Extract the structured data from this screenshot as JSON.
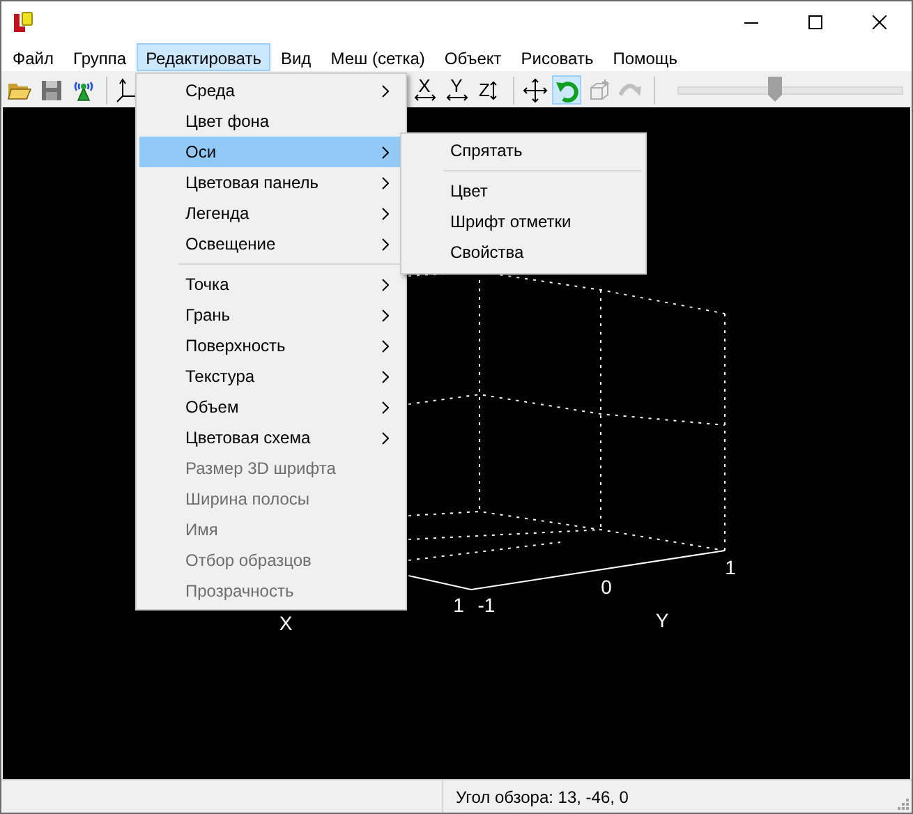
{
  "menubar": [
    {
      "label": "Файл",
      "selected": false
    },
    {
      "label": "Группа",
      "selected": false
    },
    {
      "label": "Редактировать",
      "selected": true
    },
    {
      "label": "Вид",
      "selected": false
    },
    {
      "label": "Меш (сетка)",
      "selected": false
    },
    {
      "label": "Объект",
      "selected": false
    },
    {
      "label": "Рисовать",
      "selected": false
    },
    {
      "label": "Помощь",
      "selected": false
    }
  ],
  "toolbar": {
    "left_tools": [
      {
        "kind": "button",
        "pressed": false,
        "disabled": false
      },
      {
        "kind": "button",
        "pressed": false,
        "disabled": false
      },
      {
        "kind": "button",
        "pressed": false,
        "disabled": false
      },
      {
        "kind": "separator"
      },
      {
        "kind": "button",
        "pressed": false,
        "disabled": false
      }
    ],
    "right_tools": [
      {
        "kind": "button",
        "label": "X",
        "pressed": false,
        "disabled": false
      },
      {
        "kind": "button",
        "label": "Y",
        "pressed": false,
        "disabled": false
      },
      {
        "kind": "button",
        "label": "Z",
        "pressed": false,
        "disabled": false
      },
      {
        "kind": "separator"
      },
      {
        "kind": "button",
        "pressed": false,
        "disabled": false
      },
      {
        "kind": "button",
        "pressed": true,
        "disabled": false
      },
      {
        "kind": "button",
        "pressed": false,
        "disabled": true
      },
      {
        "kind": "button",
        "pressed": false,
        "disabled": true
      },
      {
        "kind": "separator"
      },
      {
        "kind": "slider",
        "level": 0.43
      }
    ]
  },
  "edit_menu": [
    {
      "kind": "item",
      "label": "Среда",
      "submenu": true,
      "disabled": false,
      "selected": false
    },
    {
      "kind": "item",
      "label": "Цвет фона",
      "submenu": false,
      "disabled": false,
      "selected": false
    },
    {
      "kind": "item",
      "label": "Оси",
      "submenu": true,
      "disabled": false,
      "selected": true
    },
    {
      "kind": "item",
      "label": "Цветовая панель",
      "submenu": true,
      "disabled": false,
      "selected": false
    },
    {
      "kind": "item",
      "label": "Легенда",
      "submenu": true,
      "disabled": false,
      "selected": false
    },
    {
      "kind": "item",
      "label": "Освещение",
      "submenu": true,
      "disabled": false,
      "selected": false
    },
    {
      "kind": "separator"
    },
    {
      "kind": "item",
      "label": "Точка",
      "submenu": true,
      "disabled": false,
      "selected": false
    },
    {
      "kind": "item",
      "label": "Грань",
      "submenu": true,
      "disabled": false,
      "selected": false
    },
    {
      "kind": "item",
      "label": "Поверхность",
      "submenu": true,
      "disabled": false,
      "selected": false
    },
    {
      "kind": "item",
      "label": "Текстура",
      "submenu": true,
      "disabled": false,
      "selected": false
    },
    {
      "kind": "item",
      "label": "Объем",
      "submenu": true,
      "disabled": false,
      "selected": false
    },
    {
      "kind": "item",
      "label": "Цветовая схема",
      "submenu": true,
      "disabled": false,
      "selected": false
    },
    {
      "kind": "item",
      "label": "Размер 3D шрифта",
      "submenu": false,
      "disabled": true,
      "selected": false
    },
    {
      "kind": "item",
      "label": "Ширина полосы",
      "submenu": false,
      "disabled": true,
      "selected": false
    },
    {
      "kind": "item",
      "label": "Имя",
      "submenu": false,
      "disabled": true,
      "selected": false
    },
    {
      "kind": "item",
      "label": "Отбор образцов",
      "submenu": false,
      "disabled": true,
      "selected": false
    },
    {
      "kind": "item",
      "label": "Прозрачность",
      "submenu": false,
      "disabled": true,
      "selected": false
    }
  ],
  "axes_submenu": [
    {
      "kind": "item",
      "label": "Спрятать",
      "submenu": false,
      "disabled": false,
      "selected": false
    },
    {
      "kind": "separator"
    },
    {
      "kind": "item",
      "label": "Цвет",
      "submenu": false,
      "disabled": false,
      "selected": false
    },
    {
      "kind": "item",
      "label": "Шрифт отметки",
      "submenu": false,
      "disabled": false,
      "selected": false
    },
    {
      "kind": "item",
      "label": "Свойства",
      "submenu": false,
      "disabled": false,
      "selected": false
    }
  ],
  "plot": {
    "labels": [
      "1",
      "-1",
      "0",
      "1",
      "X",
      "Y"
    ]
  },
  "status_bar": {
    "text": "Угол обзора: 13, -46, 0"
  }
}
